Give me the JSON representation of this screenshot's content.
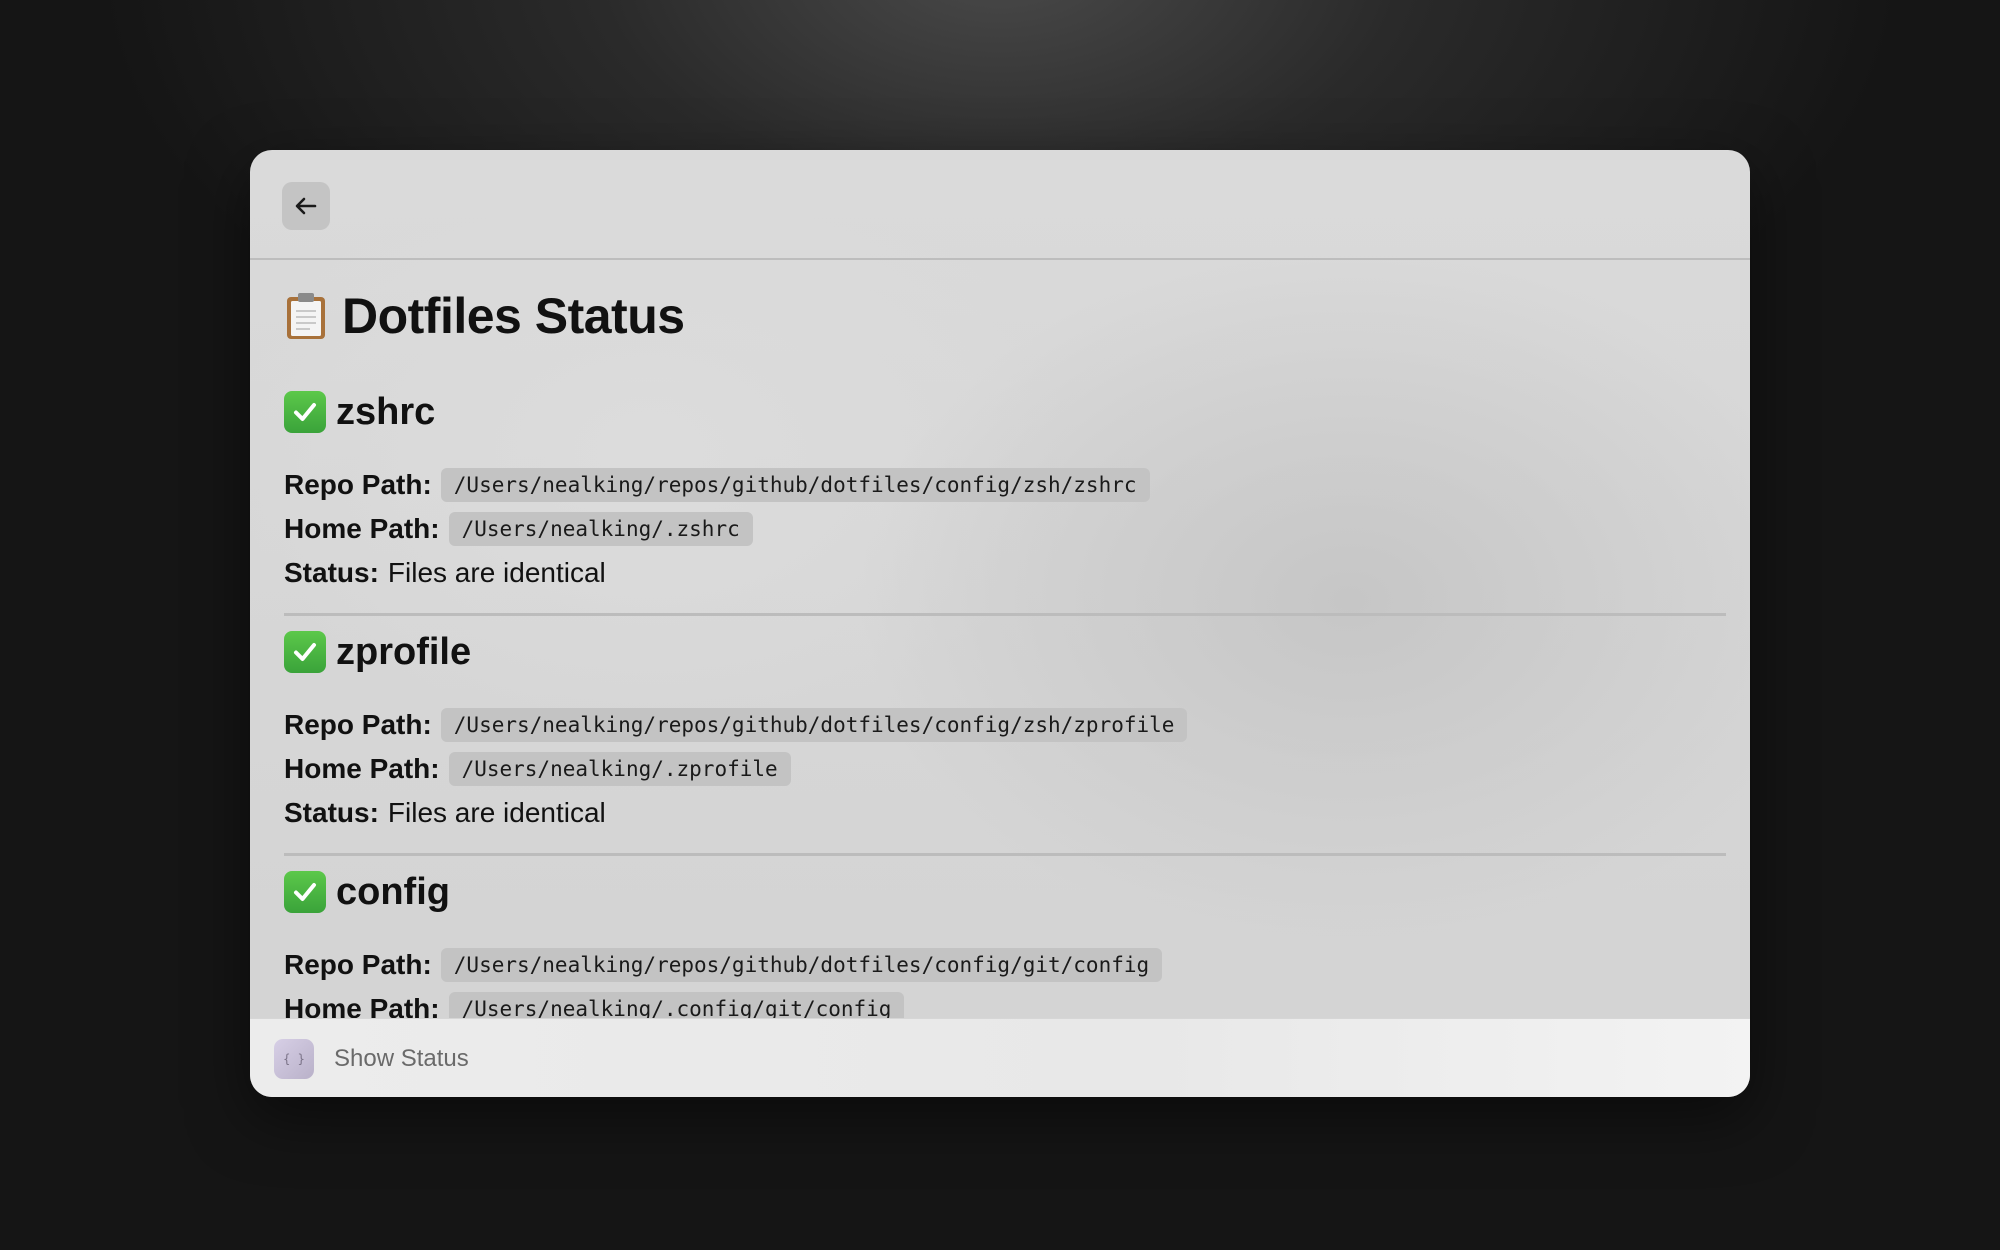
{
  "header": {
    "back_icon": "arrow-left-icon"
  },
  "page": {
    "title": "Dotfiles Status",
    "title_icon": "clipboard-icon"
  },
  "labels": {
    "repo_path": "Repo Path:",
    "home_path": "Home Path:",
    "status": "Status:"
  },
  "sections": [
    {
      "name": "zshrc",
      "icon": "check-mark-icon",
      "repo_path": "/Users/nealking/repos/github/dotfiles/config/zsh/zshrc",
      "home_path": "/Users/nealking/.zshrc",
      "status": "Files are identical"
    },
    {
      "name": "zprofile",
      "icon": "check-mark-icon",
      "repo_path": "/Users/nealking/repos/github/dotfiles/config/zsh/zprofile",
      "home_path": "/Users/nealking/.zprofile",
      "status": "Files are identical"
    },
    {
      "name": "config",
      "icon": "check-mark-icon",
      "repo_path": "/Users/nealking/repos/github/dotfiles/config/git/config",
      "home_path": "/Users/nealking/.config/git/config"
    }
  ],
  "footer": {
    "action_label": "Show Status",
    "icon": "extension-icon",
    "icon_glyph": "{ }"
  },
  "colors": {
    "check_green": "#3aa33a",
    "code_background": "#c3c3c3"
  }
}
